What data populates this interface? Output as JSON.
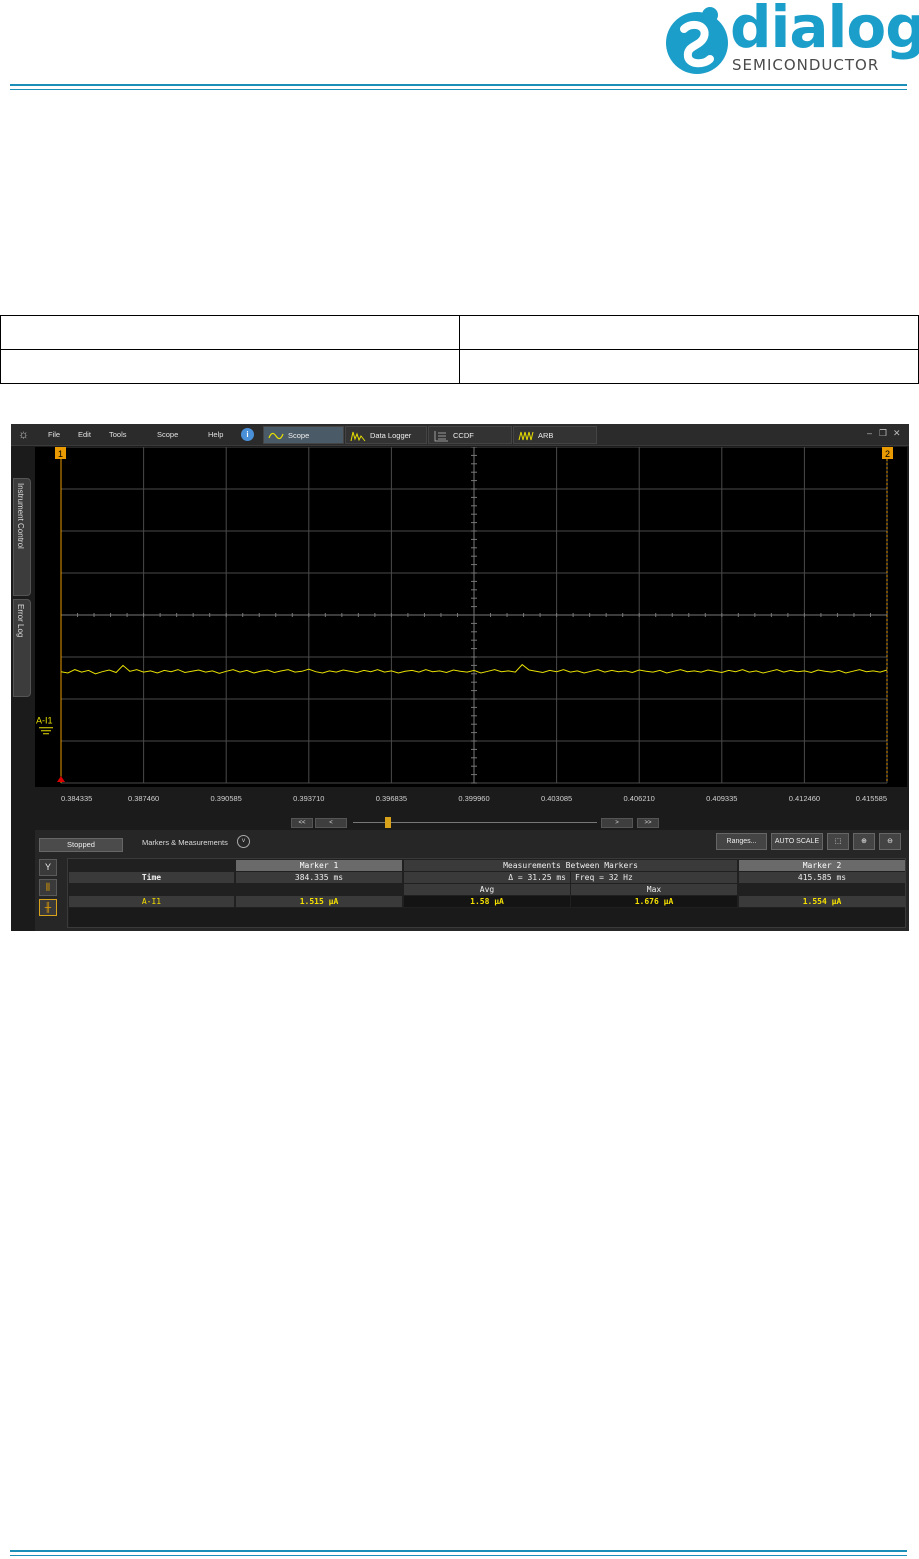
{
  "branding": {
    "logo_word": "dialog",
    "logo_sub": "SEMICONDUCTOR",
    "brand_color": "#1b9ec9"
  },
  "app": {
    "menu": [
      "File",
      "Edit",
      "Tools",
      "Scope",
      "Help"
    ],
    "tabs": [
      {
        "label": "Scope",
        "active": true,
        "icon": "sine-wave-icon"
      },
      {
        "label": "Data Logger",
        "active": false,
        "icon": "data-logger-icon"
      },
      {
        "label": "CCDF",
        "active": false,
        "icon": "ccdf-icon"
      },
      {
        "label": "ARB",
        "active": false,
        "icon": "arb-wave-icon"
      }
    ],
    "side_tabs": [
      "Instrument Control",
      "Error Log"
    ],
    "status": "Stopped",
    "panel_title": "Markers & Measurements",
    "toolbar": {
      "ranges": "Ranges...",
      "autoscale": "AUTO SCALE"
    },
    "nav_buttons": [
      "<<",
      "<",
      ">",
      ">>"
    ],
    "trace_color": "#e8e000"
  },
  "chart_data": {
    "type": "line",
    "channel_label": "A-I1",
    "marker_labels": [
      "1",
      "2"
    ],
    "x_ticks": [
      "0.384335",
      "0.387460",
      "0.390585",
      "0.393710",
      "0.396835",
      "0.399960",
      "0.403085",
      "0.406210",
      "0.409335",
      "0.412460",
      "0.415585"
    ],
    "xlim": [
      0.384335,
      0.415585
    ],
    "grid": true,
    "divisions_x": 10,
    "divisions_y": 8,
    "series": [
      {
        "color": "#e8e000",
        "level_divisions": 5.35,
        "y_divisions": [
          5.35,
          5.38,
          5.3,
          5.36,
          5.32,
          5.4,
          5.35,
          5.31,
          5.37,
          5.2,
          5.34,
          5.3,
          5.36,
          5.33,
          5.38,
          5.32,
          5.35,
          5.3,
          5.37,
          5.34,
          5.31,
          5.36,
          5.33,
          5.39,
          5.34,
          5.3,
          5.36,
          5.32,
          5.38,
          5.34,
          5.31,
          5.37,
          5.33,
          5.3,
          5.36,
          5.34,
          5.29,
          5.35,
          5.38,
          5.33,
          5.36,
          5.31,
          5.34,
          5.37,
          5.32,
          5.35,
          5.3,
          5.36,
          5.33,
          5.38,
          5.34,
          5.32,
          5.36,
          5.3,
          5.35,
          5.33,
          5.37,
          5.31,
          5.34,
          5.36,
          5.32,
          5.38,
          5.34,
          5.3,
          5.35,
          5.33,
          5.36,
          5.18,
          5.31,
          5.34,
          5.37,
          5.32,
          5.35,
          5.3,
          5.36,
          5.33,
          5.38,
          5.34,
          5.3,
          5.36,
          5.32,
          5.35,
          5.33,
          5.37,
          5.31,
          5.34,
          5.36,
          5.32,
          5.38,
          5.34,
          5.3,
          5.35,
          5.33,
          5.36,
          5.31,
          5.34,
          5.37,
          5.32,
          5.35,
          5.3,
          5.36,
          5.33,
          5.38,
          5.34,
          5.3,
          5.36,
          5.32,
          5.35,
          5.33,
          5.37,
          5.31,
          5.34,
          5.36,
          5.32,
          5.38,
          5.34,
          5.3,
          5.35,
          5.33,
          5.36,
          5.31
        ]
      }
    ]
  },
  "measurements": {
    "header": {
      "marker1": "Marker 1",
      "between": "Measurements Between Markers",
      "marker2": "Marker 2"
    },
    "time_label": "Time",
    "marker1_time": "384.335 ms",
    "delta": "Δ = 31.25 ms",
    "freq": "Freq = 32 Hz",
    "marker2_time": "415.585 ms",
    "avg_label": "Avg",
    "max_label": "Max",
    "channel": "A-I1",
    "marker1_value": "1.515 µA",
    "avg_value": "1.58 µA",
    "max_value": "1.676 µA",
    "marker2_value": "1.554 µA"
  }
}
